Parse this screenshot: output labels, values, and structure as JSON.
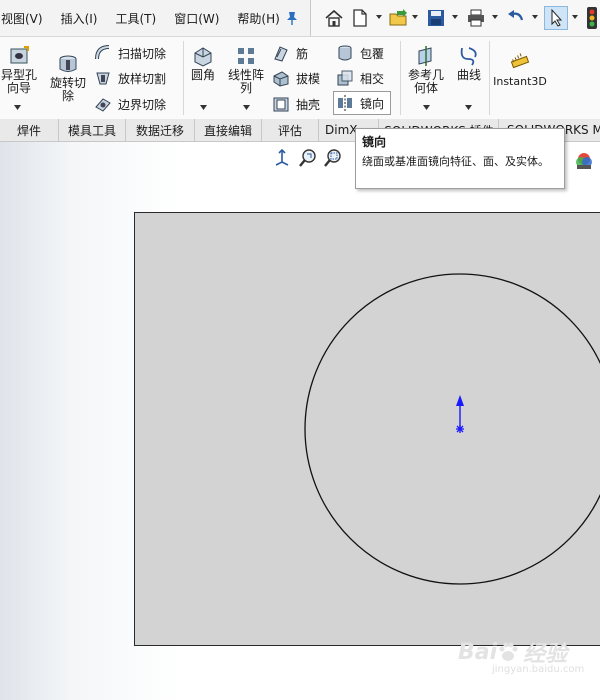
{
  "menubar": {
    "items": [
      "视图(V)",
      "插入(I)",
      "工具(T)",
      "窗口(W)",
      "帮助(H)"
    ]
  },
  "ribbon": {
    "hole_wizard": "异型孔\n向导",
    "revolved_cut": "旋转切\n除",
    "swept_cut": "扫描切除",
    "lofted_cut": "放样切割",
    "boundary_cut": "边界切除",
    "fillet": "圆角",
    "linear_pattern": "线性阵\n列",
    "rib": "筋",
    "draft": "拔模",
    "shell": "抽壳",
    "wrap": "包覆",
    "intersect": "相交",
    "mirror": "镜向",
    "ref_geometry": "参考几\n何体",
    "curves": "曲线",
    "instant3d": "Instant3D"
  },
  "tabs": [
    "焊件",
    "模具工具",
    "数据迁移",
    "直接编辑",
    "评估",
    "DimX",
    "SOLIDWORKS 插件",
    "SOLIDWORKS ME"
  ],
  "tooltip": {
    "title": "镜向",
    "body": "绕面或基准面镜向特征、面、及实体。"
  },
  "watermark": {
    "brand": "Bai",
    "brand2": "经验",
    "url": "jingyan.baidu.com"
  },
  "colors": {
    "sketch_plane": "#d3d3d3",
    "origin_arrow": "#1a1aff",
    "selected_tool": "#cfe4f7"
  }
}
